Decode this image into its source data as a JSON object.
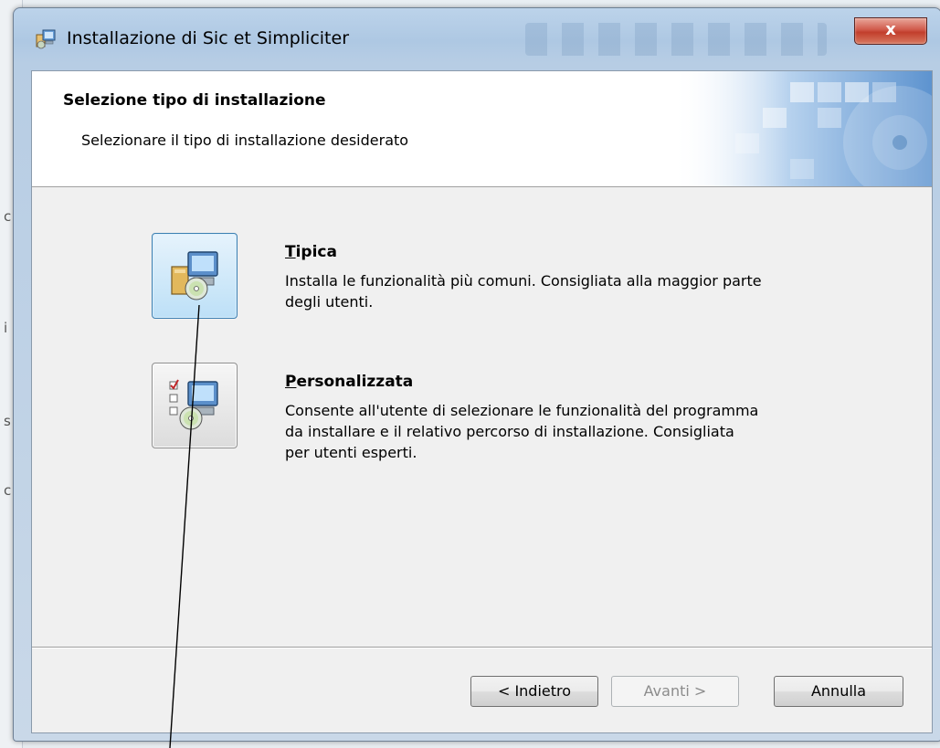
{
  "window": {
    "title": "Installazione di Sic et Simpliciter",
    "close_label": "x"
  },
  "header": {
    "title": "Selezione tipo di installazione",
    "subtitle": "Selezionare il tipo di installazione desiderato"
  },
  "options": [
    {
      "mnemonic": "T",
      "label_rest": "ipica",
      "description_lines": [
        "Installa le funzionalità più comuni. Consigliata alla maggior parte",
        "degli utenti."
      ]
    },
    {
      "mnemonic": "P",
      "label_rest": "ersonalizzata",
      "description_lines": [
        "Consente all'utente di selezionare le funzionalità del programma",
        "da installare e il relativo percorso di installazione. Consigliata",
        "per utenti esperti."
      ]
    }
  ],
  "buttons": {
    "back": "< Indietro",
    "next": "Avanti >",
    "cancel": "Annulla"
  },
  "background": {
    "edge_letters": [
      "c",
      "i",
      "s",
      "c"
    ]
  },
  "icons": {
    "title": "installer-package-icon",
    "typical": "typical-install-icon",
    "custom": "custom-install-icon"
  },
  "colors": {
    "accent_selected": "#3c7fb1",
    "close_button": "#c23e2c",
    "dialog_face": "#f0f0f0"
  }
}
